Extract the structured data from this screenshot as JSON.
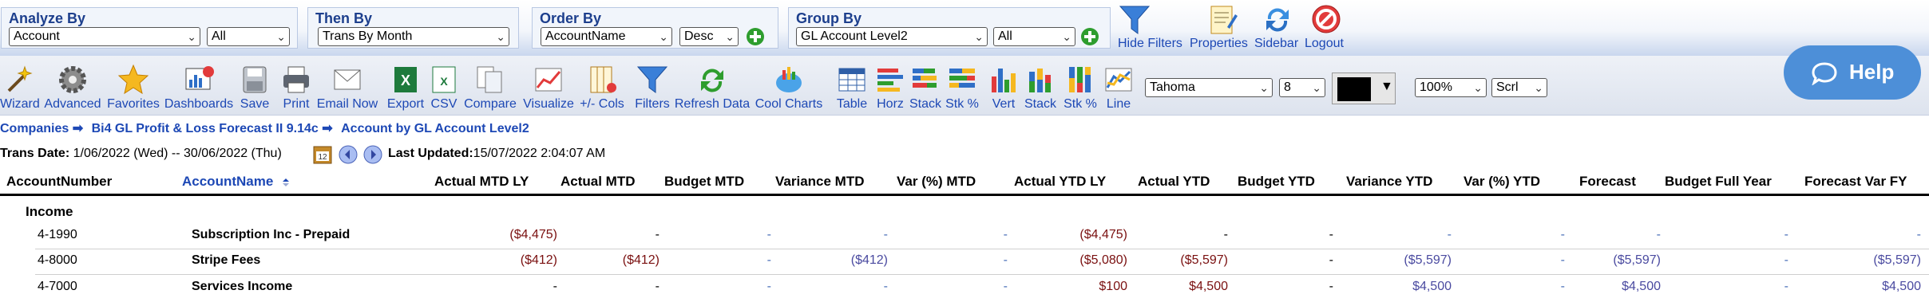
{
  "filters": {
    "analyze_by": {
      "title": "Analyze By",
      "field": "Account",
      "value": "All"
    },
    "then_by": {
      "title": "Then By",
      "field": "Trans By Month"
    },
    "order_by": {
      "title": "Order By",
      "field": "AccountName",
      "direction": "Desc"
    },
    "group_by": {
      "title": "Group By",
      "field": "GL Account Level2",
      "value": "All"
    }
  },
  "top_actions": [
    {
      "label": "Hide Filters",
      "icon": "funnel-icon"
    },
    {
      "label": "Properties",
      "icon": "properties-icon"
    },
    {
      "label": "Sidebar",
      "icon": "refresh-arrows-icon"
    },
    {
      "label": "Logout",
      "icon": "logout-icon"
    }
  ],
  "help": {
    "label": "Help"
  },
  "toolbar": {
    "items": [
      {
        "label": "Wizard",
        "icon": "wand-icon"
      },
      {
        "label": "Advanced",
        "icon": "gear-icon"
      },
      {
        "label": "Favorites",
        "icon": "star-icon"
      },
      {
        "label": "Dashboards",
        "icon": "dashboard-icon"
      },
      {
        "label": "Save",
        "icon": "save-icon"
      },
      {
        "label": "Print",
        "icon": "printer-icon"
      },
      {
        "label": "Email Now",
        "icon": "email-icon"
      },
      {
        "label": "Export",
        "icon": "excel-icon"
      },
      {
        "label": "CSV",
        "icon": "csv-icon"
      },
      {
        "label": "Compare",
        "icon": "compare-icon"
      },
      {
        "label": "Visualize",
        "icon": "visualize-icon"
      },
      {
        "label": "+/- Cols",
        "icon": "columns-icon"
      },
      {
        "label": "Filters",
        "icon": "funnel-icon"
      },
      {
        "label": "Refresh Data",
        "icon": "refresh-icon"
      },
      {
        "label": "Cool Charts",
        "icon": "cloud-chart-icon"
      },
      {
        "label": "Table",
        "icon": "table-icon"
      },
      {
        "label": "Horz",
        "icon": "horizontal-bar-icon"
      },
      {
        "label": "Stack",
        "icon": "stacked-bar-icon"
      },
      {
        "label": "Stk %",
        "icon": "stacked-percent-icon"
      },
      {
        "label": "Vert",
        "icon": "vertical-bar-icon"
      },
      {
        "label": "Stack",
        "icon": "vertical-stack-icon"
      },
      {
        "label": "Stk %",
        "icon": "vertical-stack-percent-icon"
      },
      {
        "label": "Line",
        "icon": "line-chart-icon"
      }
    ],
    "font": "Tahoma",
    "font_size": "8",
    "zoom": "100%",
    "scroll_mode": "Scrl",
    "swatch_color": "#000000"
  },
  "breadcrumb": {
    "items": [
      "Companies",
      "Bi4 GL Profit & Loss Forecast II 9.14c",
      "Account by GL Account Level2"
    ],
    "separator": "➡"
  },
  "trans": {
    "label": "Trans Date:",
    "range": "1/06/2022 (Wed) -- 30/06/2022 (Thu)",
    "updated_label": "Last Updated:",
    "updated_value": "15/07/2022 2:04:07 AM"
  },
  "table": {
    "columns": [
      "AccountNumber",
      "AccountName",
      "Actual MTD LY",
      "Actual MTD",
      "Budget MTD",
      "Variance MTD",
      "Var (%) MTD",
      "Actual YTD LY",
      "Actual YTD",
      "Budget YTD",
      "Variance YTD",
      "Var (%) YTD",
      "Forecast",
      "Budget Full Year",
      "Forecast Var FY"
    ],
    "sort_column": "AccountName",
    "group_label": "Income",
    "rows": [
      {
        "number": "4-1990",
        "name": "Subscription Inc - Prepaid",
        "values": [
          "($4,475)",
          "-",
          "-",
          "-",
          "-",
          "($4,475)",
          "-",
          "-",
          "-",
          "-",
          "-",
          "-",
          "-"
        ]
      },
      {
        "number": "4-8000",
        "name": "Stripe Fees",
        "values": [
          "($412)",
          "($412)",
          "-",
          "($412)",
          "-",
          "($5,080)",
          "($5,597)",
          "-",
          "($5,597)",
          "-",
          "($5,597)",
          "-",
          "($5,597)"
        ]
      },
      {
        "number": "4-7000",
        "name": "Services Income",
        "values": [
          "-",
          "-",
          "-",
          "-",
          "-",
          "$100",
          "$4,500",
          "-",
          "$4,500",
          "-",
          "$4,500",
          "-",
          "$4,500"
        ]
      }
    ]
  }
}
